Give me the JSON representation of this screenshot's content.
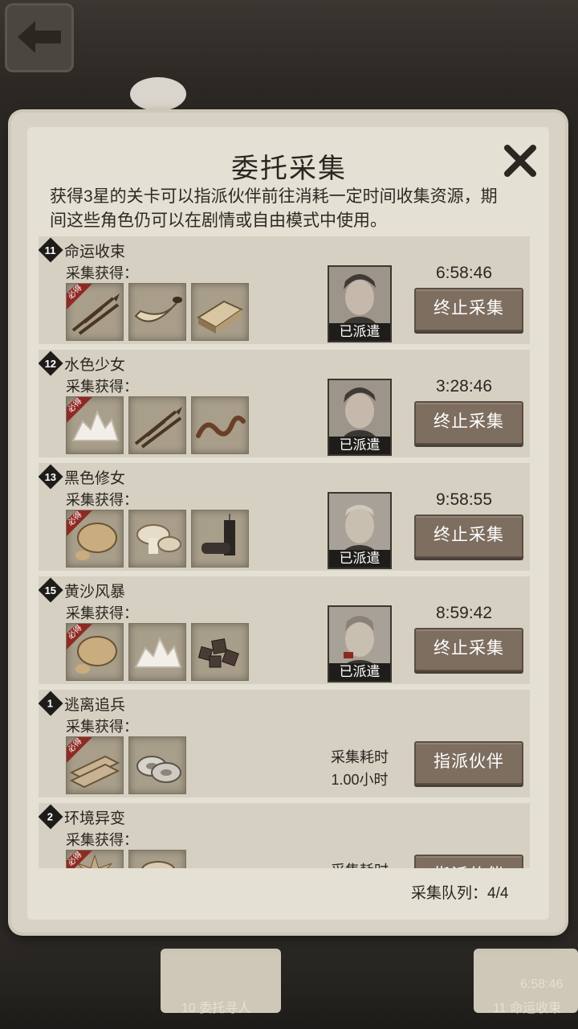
{
  "dialog": {
    "title": "委托采集",
    "description": "获得3星的关卡可以指派伙伴前往消耗一定时间收集资源，期间这些角色仍可以在剧情或自由模式中使用。",
    "queue_label": "采集队列：4/4"
  },
  "rows": [
    {
      "num": "11",
      "name": "命运收束",
      "gather_label": "采集获得：",
      "must_label": "必得",
      "items": [
        "arrows-icon",
        "horn-icon",
        "wood-plank-icon"
      ],
      "status": "已派遣",
      "timer": "6:58:46",
      "button": "终止采集"
    },
    {
      "num": "12",
      "name": "水色少女",
      "gather_label": "采集获得：",
      "must_label": "必得",
      "items": [
        "salt-crystal-icon",
        "arrows-icon",
        "worm-icon"
      ],
      "status": "已派遣",
      "timer": "3:28:46",
      "button": "终止采集"
    },
    {
      "num": "13",
      "name": "黑色修女",
      "gather_label": "采集获得：",
      "must_label": "必得",
      "items": [
        "stone-ore-icon",
        "mushroom-icon",
        "candle-icon"
      ],
      "status": "已派遣",
      "timer": "9:58:55",
      "button": "终止采集"
    },
    {
      "num": "15",
      "name": "黄沙风暴",
      "gather_label": "采集获得：",
      "must_label": "必得",
      "items": [
        "stone-ore-icon",
        "salt-crystal-icon",
        "metal-scrap-icon"
      ],
      "status": "已派遣",
      "timer": "8:59:42",
      "button": "终止采集"
    },
    {
      "num": "1",
      "name": "逃离追兵",
      "gather_label": "采集获得：",
      "must_label": "必得",
      "items": [
        "timber-icon",
        "tape-roll-icon"
      ],
      "cost_label": "采集耗时",
      "cost_value": "1.00小时",
      "button": "指派伙伴"
    },
    {
      "num": "2",
      "name": "环境异变",
      "gather_label": "采集获得：",
      "must_label": "必得",
      "items": [
        "plant-icon",
        "unknown-item-icon"
      ],
      "cost_label": "采集耗时",
      "button": "指派伙伴"
    }
  ],
  "bottom": {
    "left_num": "10",
    "left_label": "委托寻人",
    "right_num": "11",
    "right_label": "命运收束",
    "right_time": "6:58:46"
  }
}
